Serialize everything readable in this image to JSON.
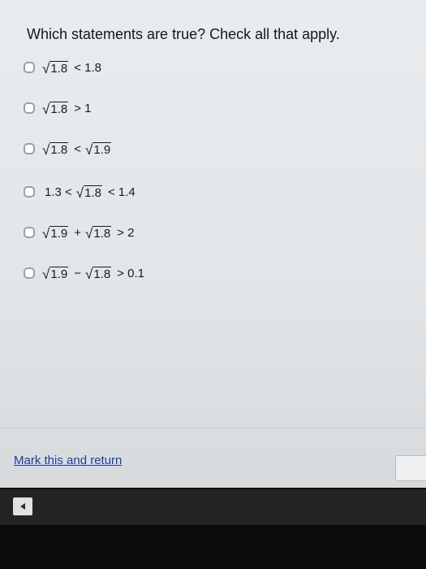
{
  "question": {
    "prompt": "Which statements are true? Check all that apply."
  },
  "options": [
    {
      "parts": [
        {
          "type": "rad",
          "text": "1.8"
        },
        {
          "type": "text",
          "text": "< 1.8"
        }
      ],
      "checked": false
    },
    {
      "parts": [
        {
          "type": "rad",
          "text": "1.8"
        },
        {
          "type": "text",
          "text": "> 1"
        }
      ],
      "checked": false
    },
    {
      "parts": [
        {
          "type": "rad",
          "text": "1.8"
        },
        {
          "type": "text",
          "text": "<"
        },
        {
          "type": "rad",
          "text": "1.9"
        }
      ],
      "checked": false
    },
    {
      "parts": [
        {
          "type": "text",
          "text": "1.3 <"
        },
        {
          "type": "rad",
          "text": "1.8"
        },
        {
          "type": "text",
          "text": "< 1.4"
        }
      ],
      "checked": false
    },
    {
      "parts": [
        {
          "type": "rad",
          "text": "1.9"
        },
        {
          "type": "text",
          "text": "+"
        },
        {
          "type": "rad",
          "text": "1.8"
        },
        {
          "type": "text",
          "text": "> 2"
        }
      ],
      "checked": false
    },
    {
      "parts": [
        {
          "type": "rad",
          "text": "1.9"
        },
        {
          "type": "text",
          "text": "−"
        },
        {
          "type": "rad",
          "text": "1.8"
        },
        {
          "type": "text",
          "text": "> 0.1"
        }
      ],
      "checked": false
    }
  ],
  "footer": {
    "mark_link": "Mark this and return"
  },
  "taskbar": {
    "back_icon": "back-arrow-icon"
  }
}
